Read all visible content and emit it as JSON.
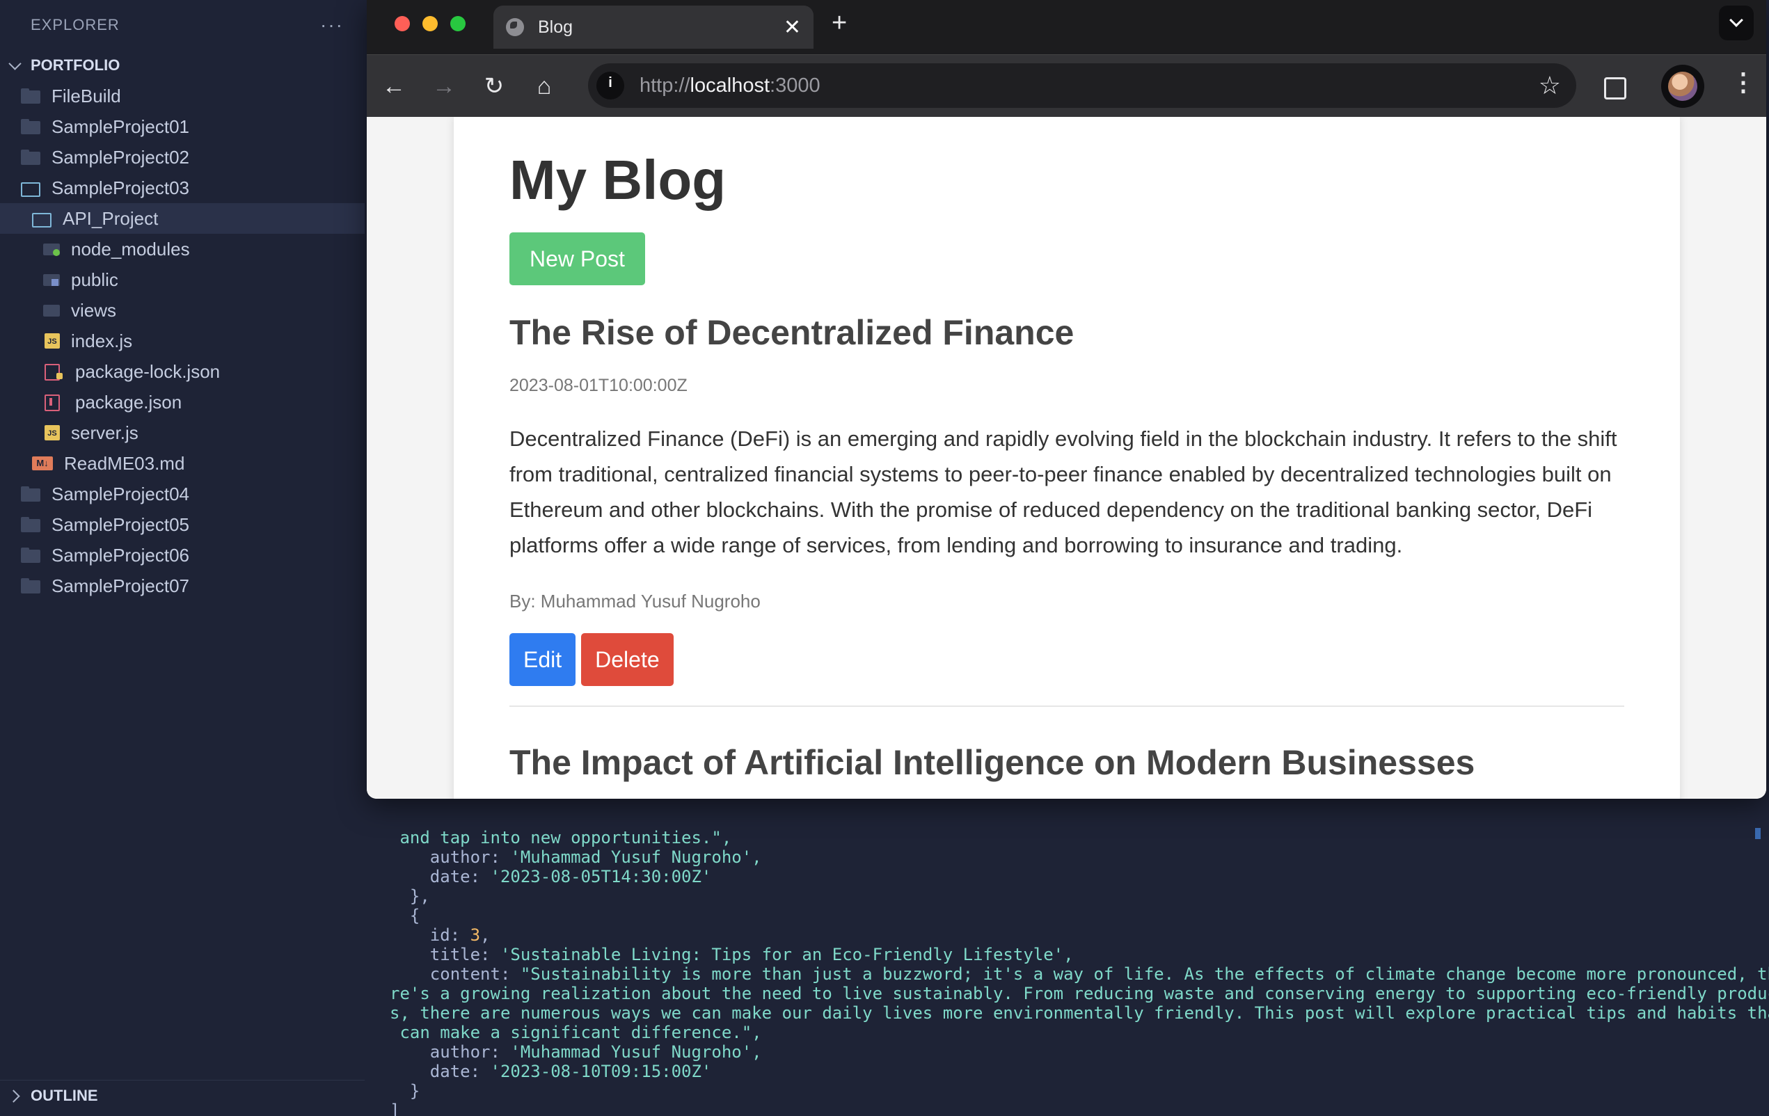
{
  "sidebar": {
    "title": "EXPLORER",
    "more": "···",
    "section": "PORTFOLIO",
    "items": [
      {
        "label": "FileBuild"
      },
      {
        "label": "SampleProject01"
      },
      {
        "label": "SampleProject02"
      },
      {
        "label": "SampleProject03"
      },
      {
        "label": "API_Project"
      },
      {
        "label": "node_modules"
      },
      {
        "label": "public"
      },
      {
        "label": "views"
      },
      {
        "label": "index.js"
      },
      {
        "label": "package-lock.json"
      },
      {
        "label": "package.json"
      },
      {
        "label": "server.js"
      },
      {
        "label": "ReadME03.md"
      },
      {
        "label": "SampleProject04"
      },
      {
        "label": "SampleProject05"
      },
      {
        "label": "SampleProject06"
      },
      {
        "label": "SampleProject07"
      }
    ],
    "outline": "OUTLINE"
  },
  "browser": {
    "tab_title": "Blog",
    "tab_close": "✕",
    "new_tab": "+",
    "url_scheme": "http://",
    "url_host": "localhost",
    "url_port": ":3000",
    "back": "←",
    "forward": "→",
    "reload": "↻",
    "home": "⌂",
    "star": "☆",
    "menu": "⋮"
  },
  "page": {
    "heading": "My Blog",
    "new_post": "New Post",
    "posts": [
      {
        "title": "The Rise of Decentralized Finance",
        "date": "2023-08-01T10:00:00Z",
        "content": "Decentralized Finance (DeFi) is an emerging and rapidly evolving field in the blockchain industry. It refers to the shift from traditional, centralized financial systems to peer-to-peer finance enabled by decentralized technologies built on Ethereum and other blockchains. With the promise of reduced dependency on the traditional banking sector, DeFi platforms offer a wide range of services, from lending and borrowing to insurance and trading.",
        "author": "By: Muhammad Yusuf Nugroho",
        "edit": "Edit",
        "delete": "Delete"
      },
      {
        "title": "The Impact of Artificial Intelligence on Modern Businesses"
      }
    ]
  },
  "code": {
    "l1": " and tap into new opportunities.\",",
    "l2_key": "    author: ",
    "l2_val": "'Muhammad Yusuf Nugroho',",
    "l3_key": "    date: ",
    "l3_val": "'2023-08-05T14:30:00Z'",
    "l4": "  },",
    "l5": "  {",
    "l6_key": "    id: ",
    "l6_val": "3",
    "l6_end": ",",
    "l7_key": "    title: ",
    "l7_val": "'Sustainable Living: Tips for an Eco-Friendly Lifestyle',",
    "l8_key": "    content: ",
    "l8_val": "\"Sustainability is more than just a buzzword; it's a way of life. As the effects of climate change become more pronounced, the",
    "l9": "re's a growing realization about the need to live sustainably. From reducing waste and conserving energy to supporting eco-friendly product",
    "l10": "s, there are numerous ways we can make our daily lives more environmentally friendly. This post will explore practical tips and habits that",
    "l11": " can make a significant difference.\",",
    "l12_key": "    author: ",
    "l12_val": "'Muhammad Yusuf Nugroho',",
    "l13_key": "    date: ",
    "l13_val": "'2023-08-10T09:15:00Z'",
    "l14": "  }",
    "l15": "]"
  }
}
